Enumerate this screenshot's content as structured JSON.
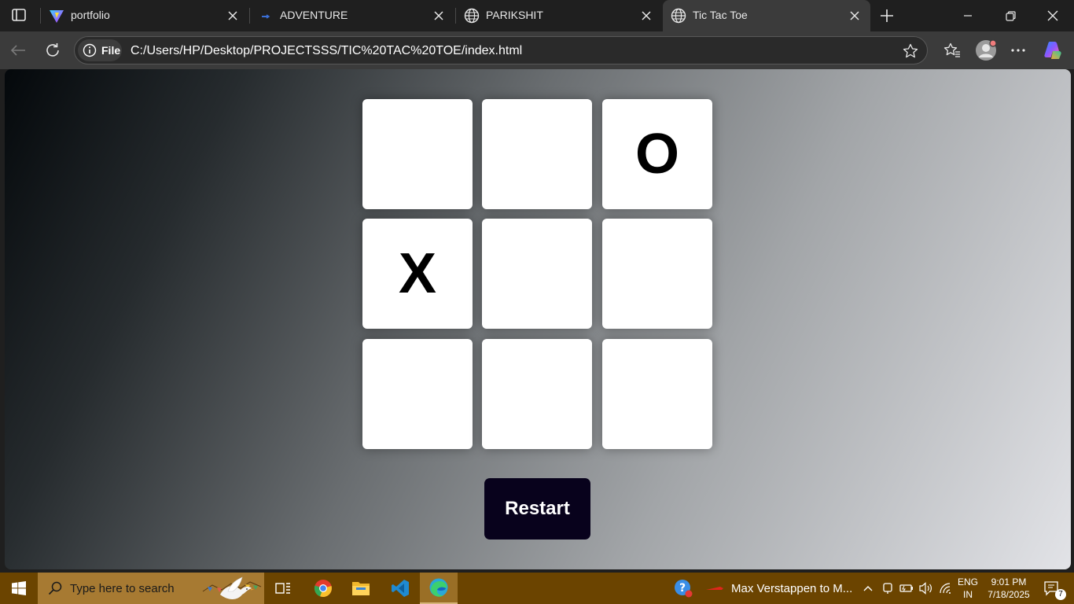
{
  "browser": {
    "tabs": [
      {
        "title": "portfolio",
        "icon": "vite-logo-icon",
        "active": false
      },
      {
        "title": "ADVENTURE",
        "icon": "adventure-favicon-icon",
        "active": false
      },
      {
        "title": "PARIKSHIT",
        "icon": "globe-icon",
        "active": false
      },
      {
        "title": "Tic Tac Toe",
        "icon": "globe-icon",
        "active": true
      }
    ],
    "address": {
      "site_label": "File",
      "url": "C:/Users/HP/Desktop/PROJECTSSS/TIC%20TAC%20TOE/index.html"
    }
  },
  "game": {
    "cells": [
      "",
      "",
      "O",
      "X",
      "",
      "",
      "",
      "",
      ""
    ],
    "restart_label": "Restart"
  },
  "taskbar": {
    "search_placeholder": "Type here to search",
    "news_headline": "Max Verstappen to M...",
    "language": "ENG",
    "region": "IN",
    "time": "9:01 PM",
    "date": "7/18/2025",
    "notification_count": "7"
  },
  "colors": {
    "restart_button": "#08021c",
    "taskbar": "#6b4400",
    "tab_strip": "#1f1f1f",
    "toolbar": "#3b3b3b"
  }
}
